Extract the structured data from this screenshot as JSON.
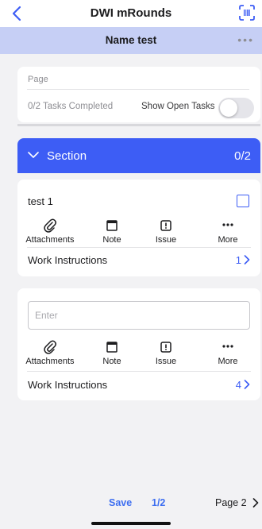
{
  "nav": {
    "title": "DWI mRounds",
    "back_icon": "chevron-left-icon",
    "scan_icon": "barcode-scan-icon"
  },
  "header": {
    "name": "Name test",
    "more_label": "•••"
  },
  "page_card": {
    "label": "Page",
    "tasks_completed": "0/2  Tasks Completed",
    "show_open_label": "Show Open Tasks",
    "show_open_enabled": false
  },
  "section": {
    "title": "Section",
    "count": "0/2",
    "expanded": true
  },
  "tasks": [
    {
      "title": "test 1",
      "checked": false,
      "actions": [
        {
          "label": "Attachments",
          "icon": "paperclip-icon"
        },
        {
          "label": "Note",
          "icon": "note-icon"
        },
        {
          "label": "Issue",
          "icon": "issue-icon"
        },
        {
          "label": "More",
          "icon": "more-icon"
        }
      ],
      "work_instructions_label": "Work Instructions",
      "work_instructions_count": "1"
    },
    {
      "input_value": "",
      "input_placeholder": "Enter",
      "actions": [
        {
          "label": "Attachments",
          "icon": "paperclip-icon"
        },
        {
          "label": "Note",
          "icon": "note-icon"
        },
        {
          "label": "Issue",
          "icon": "issue-icon"
        },
        {
          "label": "More",
          "icon": "more-icon"
        }
      ],
      "work_instructions_label": "Work Instructions",
      "work_instructions_count": "4"
    }
  ],
  "footer": {
    "save_label": "Save",
    "page_index": "1/2",
    "next_page_label": "Page 2"
  },
  "colors": {
    "accent": "#3d5df5",
    "header_bg": "#c6cff5",
    "link_blue": "#3d6ef0"
  }
}
